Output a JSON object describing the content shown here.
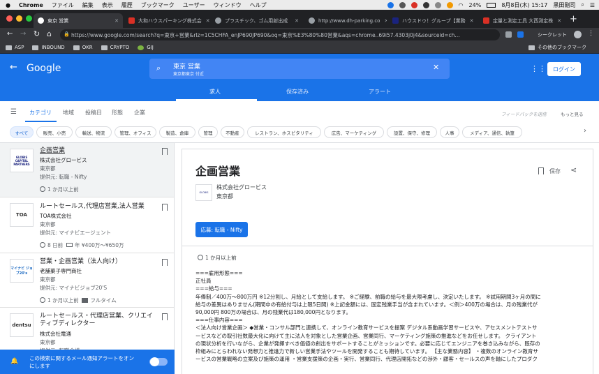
{
  "menubar": {
    "app": "Chrome",
    "items": [
      "ファイル",
      "編集",
      "表示",
      "履歴",
      "ブックマーク",
      "ユーザー",
      "ウィンドウ",
      "ヘルプ"
    ],
    "battery": "24%",
    "datetime": "8月8日(木) 15:17",
    "user": "黒田剛司"
  },
  "tabs": [
    {
      "title": "東京 営業",
      "active": true,
      "color": "#4285f4"
    },
    {
      "title": "大和ハウスパーキング株式会",
      "color": "#d93025"
    },
    {
      "title": "プラスチック、ゴム用射出成",
      "color": "#9aa0a6"
    },
    {
      "title": "http://www.dh-parking.co",
      "color": "#9aa0a6"
    },
    {
      "title": "ハウスドゥ！グループ【業務",
      "color": "#1a237e"
    },
    {
      "title": "定量と測定工具 大西測定株",
      "color": "#d93025"
    }
  ],
  "toolbar": {
    "url": "https://www.google.com/search?q=東京+営業&rlz=1C5CHFA_enJP690JP690&oq=東京%E3%80%80営業&aqs=chrome..69i57.4303j0j4&sourceid=ch...",
    "incognito": "シークレット"
  },
  "bookmarks": {
    "items": [
      "ASP",
      "INBOUND",
      "OKR",
      "CRYPTO",
      "GIJ"
    ],
    "other": "その他のブックマーク"
  },
  "google": {
    "logo": "Google",
    "query": "東京 営業",
    "location": "東京都東京 付近",
    "login": "ログイン",
    "tabs": [
      "求人",
      "保存済み",
      "アラート"
    ]
  },
  "filters": {
    "tabs": [
      "カテゴリ",
      "地域",
      "投稿日",
      "形態",
      "企業"
    ],
    "feedback": "フィードバックを送信",
    "more": "もっと見る",
    "chips": [
      "すべて",
      "販売、小売",
      "輸送、物流",
      "管理、オフィス",
      "製造、倉庫",
      "管理",
      "不動産",
      "レストラン、ホスピタリティ",
      "広告、マーケティング",
      "設置、保守、修理",
      "人事",
      "メディア、通信、執筆"
    ]
  },
  "jobs": [
    {
      "title": "企画営業",
      "company": "株式会社グロービス",
      "location": "東京都",
      "via": "提供元: 転職 - Nifty",
      "posted": "1 か月以上前",
      "salary": "",
      "type": "",
      "logo": "GLOBIS CAPITAL PARTNERS"
    },
    {
      "title": "ルートセールス,代理店営業,法人営業",
      "company": "TOA株式会社",
      "location": "東京都",
      "via": "提供元: マイナビエージェント",
      "posted": "8 日前",
      "salary": "年 ¥400万～¥650万",
      "type": "",
      "logo": "TOA"
    },
    {
      "title": "営業・企画営業（法人向け）",
      "company": "老舗菓子専門商社",
      "location": "東京都",
      "via": "提供元: マイナビジョブ20'S",
      "posted": "1 か月以上前",
      "salary": "",
      "type": "フルタイム",
      "logo": "マイナビ ジョブ20's"
    },
    {
      "title": "ルートセールス・代理店営業、クリエイティブディレクター",
      "company": "株式会社電通",
      "location": "東京都",
      "via": "提供元: 転職会議",
      "posted": "",
      "salary": "",
      "type": "",
      "logo": "dentsu"
    }
  ],
  "alert": {
    "text": "この検索に関するメール通知アラートをオンにします"
  },
  "detail": {
    "title": "企画営業",
    "company": "株式会社グロービス",
    "location": "東京都",
    "apply": "応募: 転職 - Nifty",
    "save": "保存",
    "posted": "1 か月以上前",
    "lines": [
      "===雇用形態===",
      "正社員",
      "===給与===",
      "年俸制／400万～800万円 ※12分割し、月給として支給します。 ※ご経験、前職の給与を最大限考慮し、決定いたします。 ※試用期間3ヶ月の間に",
      "給与の差異はありません(期間中の有給付与は上限5日間) ※上記金額には、固定残業手当が含まれています。＜例＞400万の場合は、月の残業代が",
      "90,000円 800万の場合は、月の残業代は180,000円となります。",
      "===仕事内容===",
      "＜法人向け営業企画＞ ◆営業・コンサル部門と連携して、オンライン教育サービスを提案 デジタル系動画学習サービスや、アセスメントテストサ",
      "ービスなどの取引社数最大化に向けて主に法人を対象とした営業企画、営業同行、マーケティング施策の推進などをお任せします。 クライアント",
      "の現状分析を行いながら、企業が発揮すべき価値の創出をサポートすることがミッションです。必要に応じてエンジニアを巻き込みながら、既存の",
      "枠組みにとらわれない発想力と推進力で新しい営業手法やツールを開発することも期待しています。 【主な業務内容】 ・複数のオンライン教育サ",
      "ービスの営業戦略の立案及び施策の運用 ・営業支援策の企画・実行、営業同行、代理店開拓などの渉外・顧客・セールスの声を軸にしたプロダク"
    ]
  },
  "colors": {
    "google_blue": "#1a73e8",
    "chrome_dark": "#202124"
  }
}
